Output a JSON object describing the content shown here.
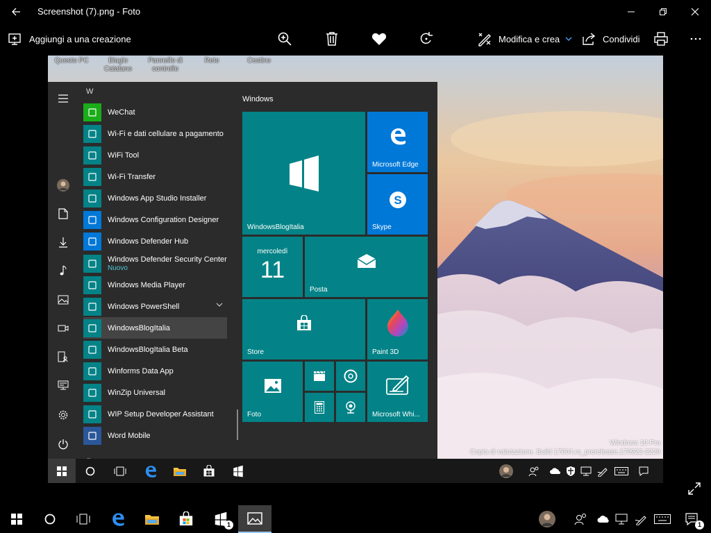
{
  "window": {
    "title": "Screenshot (7).png - Foto"
  },
  "toolbar": {
    "add_to_creation": "Aggiungi a una creazione",
    "edit_create": "Modifica e crea",
    "share": "Condividi"
  },
  "desktop_icons": [
    "Questo PC",
    "Biagio Catalano",
    "Pannello di controllo",
    "Rete",
    "Cestino"
  ],
  "start_menu": {
    "letter": "W",
    "apps": [
      {
        "label": "WeChat",
        "icon": "wechat-icon",
        "color": "#1aad19"
      },
      {
        "label": "Wi-Fi e dati cellulare a pagamento",
        "icon": "wifi-pay-icon",
        "color": "#038387"
      },
      {
        "label": "WiFi Tool",
        "icon": "wifi-tool-icon",
        "color": "#038387"
      },
      {
        "label": "Wi-Fi Transfer",
        "icon": "wifi-transfer-icon",
        "color": "#038387"
      },
      {
        "label": "Windows App Studio Installer",
        "icon": "app-studio-icon",
        "color": "#038387"
      },
      {
        "label": "Windows Configuration Designer",
        "icon": "config-designer-icon",
        "color": "#0078d7"
      },
      {
        "label": "Windows Defender Hub",
        "icon": "defender-hub-icon",
        "color": "#0078d7"
      },
      {
        "label": "Windows Defender Security Center",
        "sub": "Nuovo",
        "icon": "defender-shield-icon",
        "color": "#038387"
      },
      {
        "label": "Windows Media Player",
        "icon": "media-player-icon",
        "color": "#038387"
      },
      {
        "label": "Windows PowerShell",
        "icon": "folder-icon",
        "color": "#038387"
      },
      {
        "label": "WindowsBlogItalia",
        "icon": "wbi-icon",
        "color": "#038387"
      },
      {
        "label": "WindowsBlogItalia Beta",
        "icon": "wbi-beta-icon",
        "color": "#038387"
      },
      {
        "label": "Winforms Data App",
        "icon": "winforms-icon",
        "color": "#038387"
      },
      {
        "label": "WinZip Universal",
        "icon": "winzip-icon",
        "color": "#038387"
      },
      {
        "label": "WIP Setup Developer Assistant",
        "icon": "wip-icon",
        "color": "#038387"
      },
      {
        "label": "Word Mobile",
        "icon": "word-icon",
        "color": "#2b579a"
      }
    ],
    "group_title": "Windows",
    "tiles": {
      "wbi": "WindowsBlogItalia",
      "edge": "Microsoft Edge",
      "skype": "Skype",
      "cal_day": "mercoledì",
      "cal_date": "11",
      "mail": "Posta",
      "store": "Store",
      "paint3d": "Paint 3D",
      "photos": "Foto",
      "whiteboard": "Microsoft Whi..."
    }
  },
  "watermark": {
    "line1": "Windows 10 Pro",
    "line2": "Copia di valutazione. Build 17004.rs_prerelease.170922-2229"
  },
  "taskbar": {
    "badge_count": "1"
  },
  "colors": {
    "tile": "#038387",
    "edge_tile": "#0078d7",
    "skype_tile": "#0078d7",
    "start_bg": "#2b2b2b",
    "accent": "#0078d7"
  }
}
